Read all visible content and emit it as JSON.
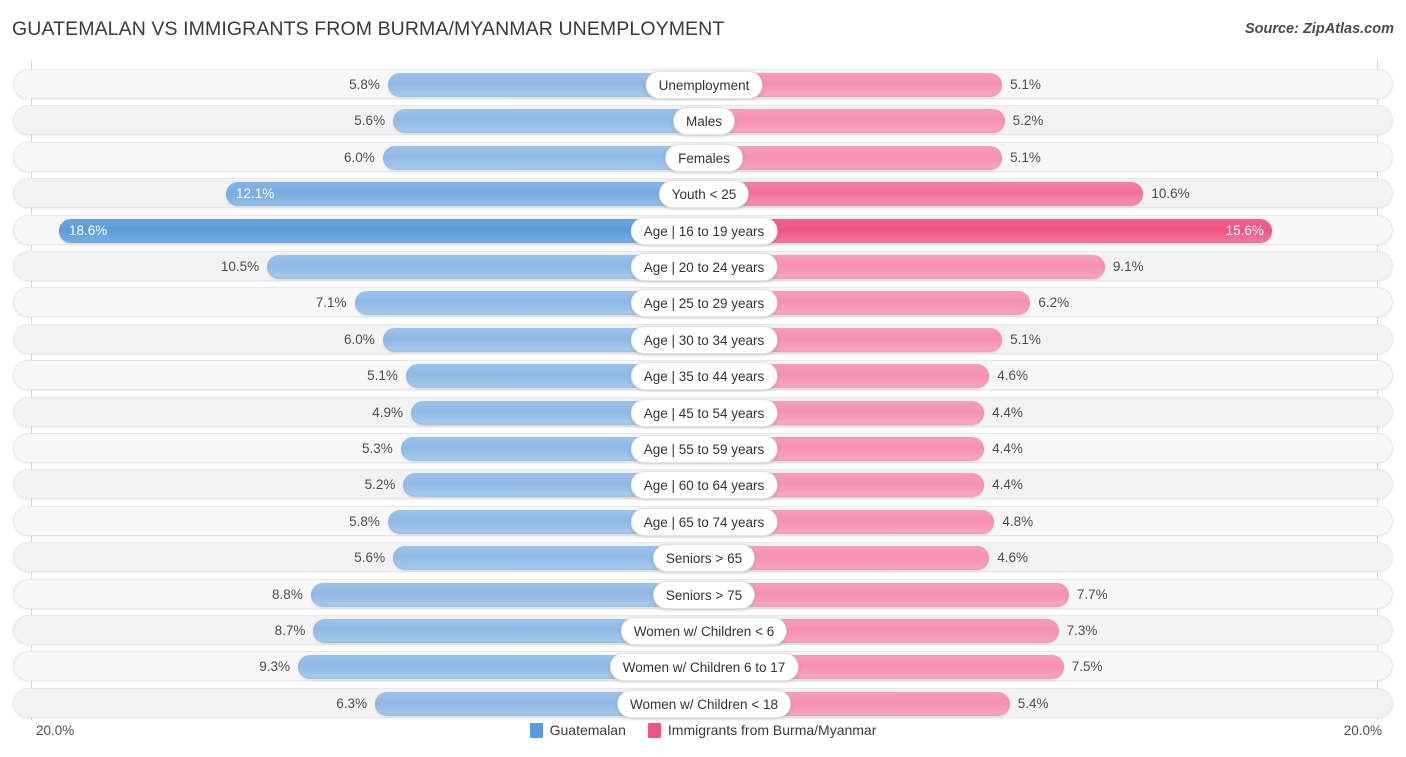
{
  "header": {
    "title": "GUATEMALAN VS IMMIGRANTS FROM BURMA/MYANMAR UNEMPLOYMENT",
    "source": "Source: ZipAtlas.com"
  },
  "legend": {
    "items": [
      {
        "label": "Guatemalan",
        "color": "#5b9bd9"
      },
      {
        "label": "Immigrants from Burma/Myanmar",
        "color": "#ef5585"
      }
    ]
  },
  "axis": {
    "left_label": "20.0%",
    "right_label": "20.0%",
    "max": 20.0
  },
  "chart_data": {
    "type": "bar",
    "orientation": "horizontal-diverging",
    "title": "GUATEMALAN VS IMMIGRANTS FROM BURMA/MYANMAR UNEMPLOYMENT",
    "xlabel": "",
    "ylabel": "",
    "xlim": [
      20.0,
      20.0
    ],
    "grid": true,
    "legend_position": "bottom-center",
    "categories": [
      "Unemployment",
      "Males",
      "Females",
      "Youth < 25",
      "Age | 16 to 19 years",
      "Age | 20 to 24 years",
      "Age | 25 to 29 years",
      "Age | 30 to 34 years",
      "Age | 35 to 44 years",
      "Age | 45 to 54 years",
      "Age | 55 to 59 years",
      "Age | 60 to 64 years",
      "Age | 65 to 74 years",
      "Seniors > 65",
      "Seniors > 75",
      "Women w/ Children < 6",
      "Women w/ Children 6 to 17",
      "Women w/ Children < 18"
    ],
    "series": [
      {
        "name": "Guatemalan",
        "color": "#8fb8e4",
        "values": [
          5.8,
          5.6,
          6.0,
          12.1,
          18.6,
          10.5,
          7.1,
          6.0,
          5.1,
          4.9,
          5.3,
          5.2,
          5.8,
          5.6,
          8.8,
          8.7,
          9.3,
          6.3
        ],
        "labels": [
          "5.8%",
          "5.6%",
          "6.0%",
          "12.1%",
          "18.6%",
          "10.5%",
          "7.1%",
          "6.0%",
          "5.1%",
          "4.9%",
          "5.3%",
          "5.2%",
          "5.8%",
          "5.6%",
          "8.8%",
          "8.7%",
          "9.3%",
          "6.3%"
        ]
      },
      {
        "name": "Immigrants from Burma/Myanmar",
        "color": "#f490b2",
        "values": [
          5.1,
          5.2,
          5.1,
          10.6,
          15.6,
          9.1,
          6.2,
          5.1,
          4.6,
          4.4,
          4.4,
          4.4,
          4.8,
          4.6,
          7.7,
          7.3,
          7.5,
          5.4
        ],
        "labels": [
          "5.1%",
          "5.2%",
          "5.1%",
          "10.6%",
          "15.6%",
          "9.1%",
          "6.2%",
          "5.1%",
          "4.6%",
          "4.4%",
          "4.4%",
          "4.4%",
          "4.8%",
          "4.6%",
          "7.7%",
          "7.3%",
          "7.5%",
          "5.4%"
        ]
      }
    ]
  },
  "rows": [
    {
      "category": "Unemployment",
      "left_label": "5.8%",
      "right_label": "5.1%",
      "left_value": 5.8,
      "right_value": 5.1,
      "style": "normal"
    },
    {
      "category": "Males",
      "left_label": "5.6%",
      "right_label": "5.2%",
      "left_value": 5.6,
      "right_value": 5.2,
      "style": "normal"
    },
    {
      "category": "Females",
      "left_label": "6.0%",
      "right_label": "5.1%",
      "left_value": 6.0,
      "right_value": 5.1,
      "style": "normal"
    },
    {
      "category": "Youth < 25",
      "left_label": "12.1%",
      "right_label": "10.6%",
      "left_value": 12.1,
      "right_value": 10.6,
      "style": "hi"
    },
    {
      "category": "Age | 16 to 19 years",
      "left_label": "18.6%",
      "right_label": "15.6%",
      "left_value": 18.6,
      "right_value": 15.6,
      "style": "max"
    },
    {
      "category": "Age | 20 to 24 years",
      "left_label": "10.5%",
      "right_label": "9.1%",
      "left_value": 10.5,
      "right_value": 9.1,
      "style": "normal"
    },
    {
      "category": "Age | 25 to 29 years",
      "left_label": "7.1%",
      "right_label": "6.2%",
      "left_value": 7.1,
      "right_value": 6.2,
      "style": "normal"
    },
    {
      "category": "Age | 30 to 34 years",
      "left_label": "6.0%",
      "right_label": "5.1%",
      "left_value": 6.0,
      "right_value": 5.1,
      "style": "normal"
    },
    {
      "category": "Age | 35 to 44 years",
      "left_label": "5.1%",
      "right_label": "4.6%",
      "left_value": 5.1,
      "right_value": 4.6,
      "style": "normal"
    },
    {
      "category": "Age | 45 to 54 years",
      "left_label": "4.9%",
      "right_label": "4.4%",
      "left_value": 4.9,
      "right_value": 4.4,
      "style": "normal"
    },
    {
      "category": "Age | 55 to 59 years",
      "left_label": "5.3%",
      "right_label": "4.4%",
      "left_value": 5.3,
      "right_value": 4.4,
      "style": "normal"
    },
    {
      "category": "Age | 60 to 64 years",
      "left_label": "5.2%",
      "right_label": "4.4%",
      "left_value": 5.2,
      "right_value": 4.4,
      "style": "normal"
    },
    {
      "category": "Age | 65 to 74 years",
      "left_label": "5.8%",
      "right_label": "4.8%",
      "left_value": 5.8,
      "right_value": 4.8,
      "style": "normal"
    },
    {
      "category": "Seniors > 65",
      "left_label": "5.6%",
      "right_label": "4.6%",
      "left_value": 5.6,
      "right_value": 4.6,
      "style": "normal"
    },
    {
      "category": "Seniors > 75",
      "left_label": "8.8%",
      "right_label": "7.7%",
      "left_value": 8.8,
      "right_value": 7.7,
      "style": "normal"
    },
    {
      "category": "Women w/ Children < 6",
      "left_label": "8.7%",
      "right_label": "7.3%",
      "left_value": 8.7,
      "right_value": 7.3,
      "style": "normal"
    },
    {
      "category": "Women w/ Children 6 to 17",
      "left_label": "9.3%",
      "right_label": "7.5%",
      "left_value": 9.3,
      "right_value": 7.5,
      "style": "normal"
    },
    {
      "category": "Women w/ Children < 18",
      "left_label": "6.3%",
      "right_label": "5.4%",
      "left_value": 6.3,
      "right_value": 5.4,
      "style": "normal"
    }
  ]
}
